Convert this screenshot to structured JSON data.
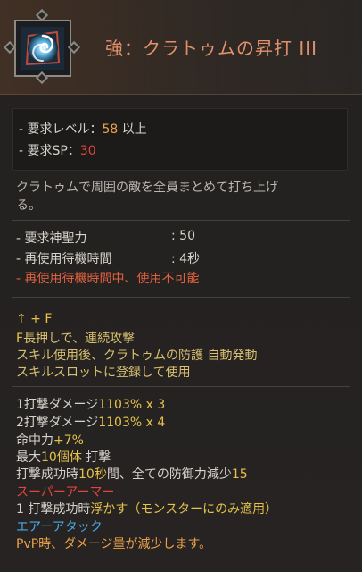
{
  "skill": {
    "title": "強：クラトゥムの昇打 III",
    "icon": "swirl-skill-icon"
  },
  "requirements": {
    "level_label": "- 要求レベル：",
    "level_value": "58",
    "level_suffix": " 以上",
    "sp_label": "- 要求SP：",
    "sp_value": "30"
  },
  "description": [
    "クラトゥムで周囲の敵を全員まとめて打ち上げ",
    "る。"
  ],
  "stats": {
    "divine_label": "- 要求神聖力",
    "divine_value": ": 50",
    "cooldown_label": "- 再使用待機時間",
    "cooldown_value": ": 4秒",
    "cooldown_warning": "- 再使用待機時間中、使用不可能"
  },
  "controls": {
    "keys": "↑ + F",
    "f_hold_prefix": "F",
    "f_hold_suffix": "長押しで、連続攻撃",
    "line2": "スキル使用後、クラトゥムの防護 自動発動",
    "line3": "スキルスロットに登録して使用"
  },
  "effects": {
    "hit1_label": "1打撃ダメージ",
    "hit1_value": "1103% x 3",
    "hit2_label": "2打撃ダメージ",
    "hit2_value": "1103% x 4",
    "accuracy_label": "命中力",
    "accuracy_value": "+7%",
    "max_targets_prefix": "最大",
    "max_targets_value": "10個体",
    "max_targets_suffix": " 打撃",
    "defense_prefix": "打撃成功時",
    "defense_duration": "10秒",
    "defense_mid": "間、全ての防御力減少",
    "defense_value": "15",
    "super_armor": "スーパーアーマー",
    "float_prefix": "1 打撃成功時",
    "float_value": "浮かす",
    "float_suffix": "（モンスターにのみ適用）",
    "air_attack": "エアーアタック",
    "pvp_note": "PvP時、ダメージ量が減少します。"
  }
}
